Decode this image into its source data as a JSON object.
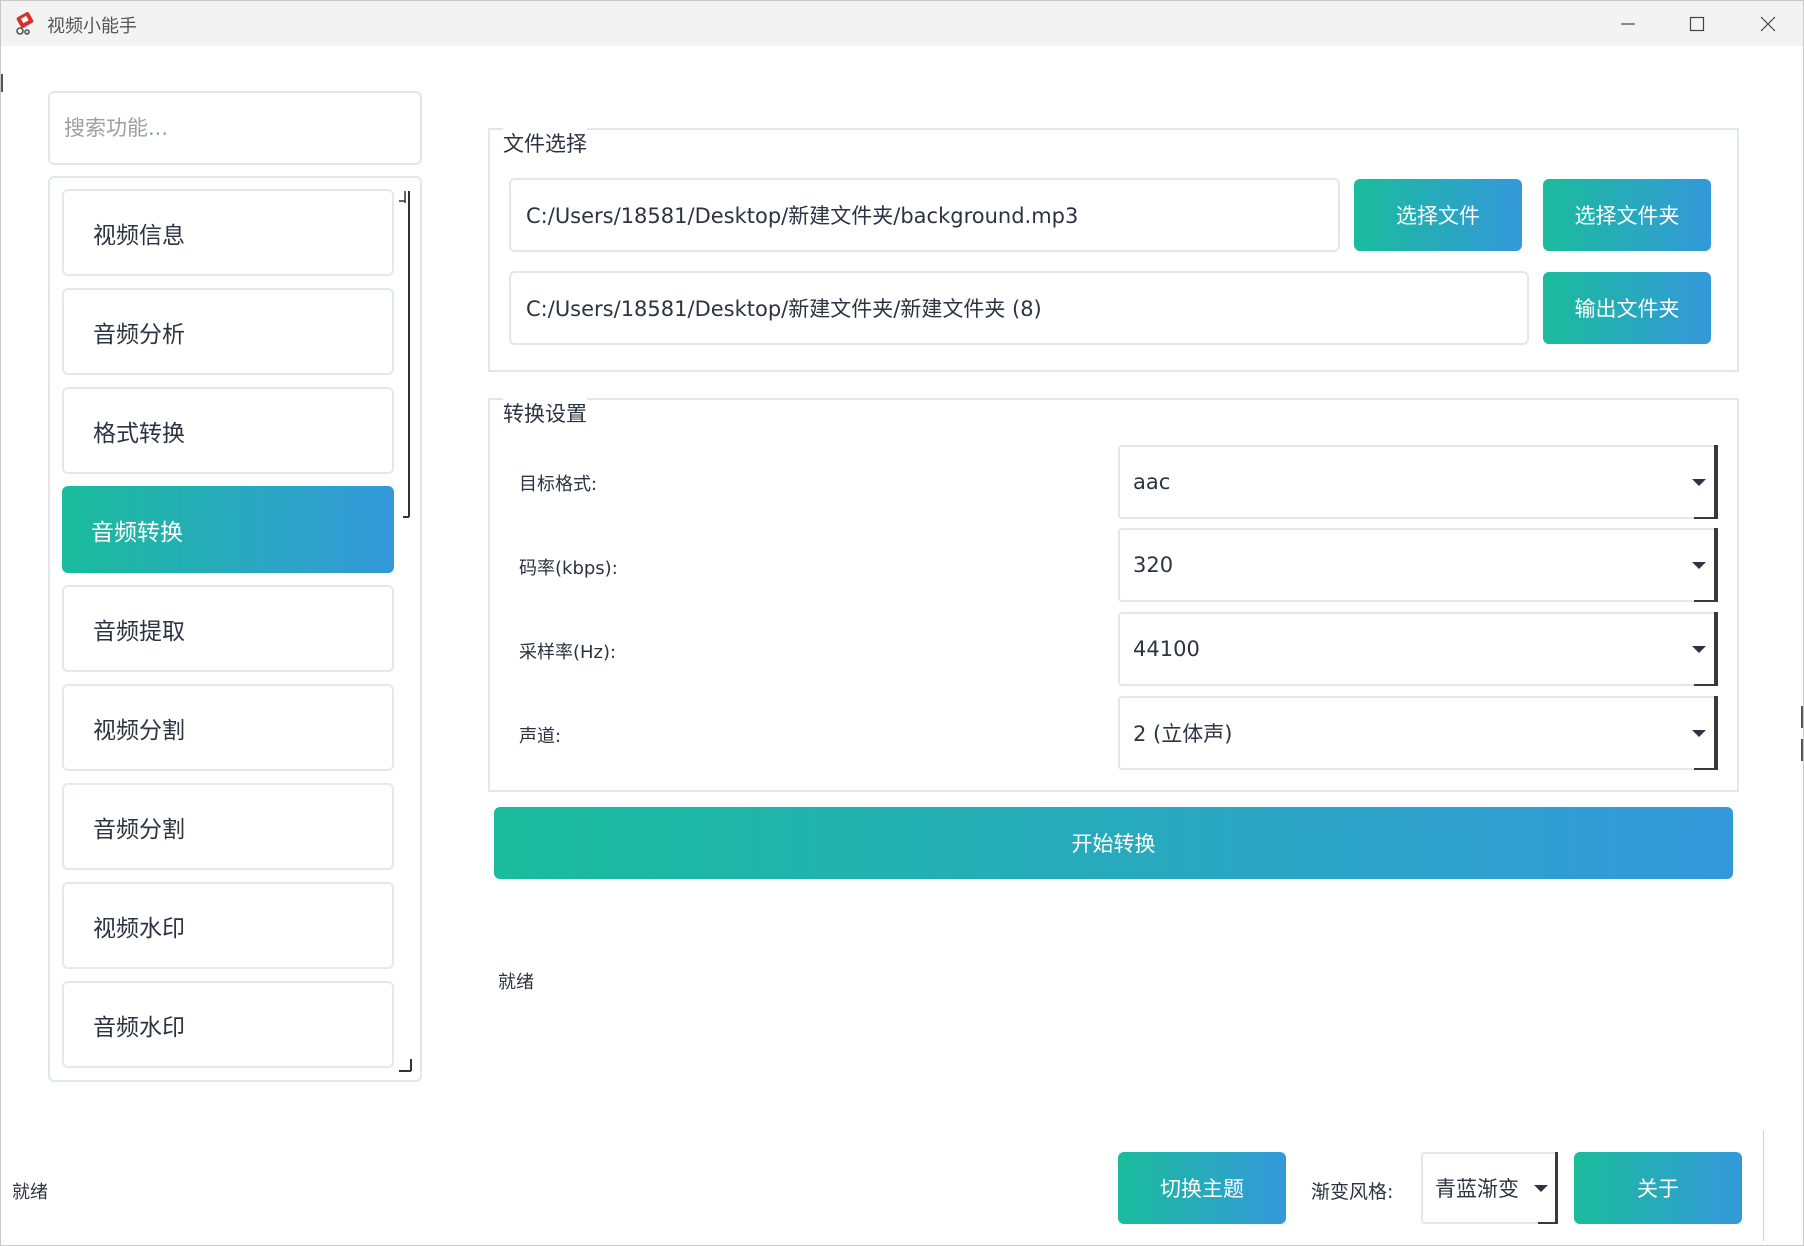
{
  "window": {
    "title": "视频小能手",
    "app_icon": "app-logo-icon",
    "controls": [
      "minimize-icon",
      "maximize-icon",
      "close-icon"
    ]
  },
  "sidebar": {
    "search_placeholder": "搜索功能...",
    "items": [
      {
        "label": "视频信息",
        "active": false
      },
      {
        "label": "音频分析",
        "active": false
      },
      {
        "label": "格式转换",
        "active": false
      },
      {
        "label": "音频转换",
        "active": true
      },
      {
        "label": "音频提取",
        "active": false
      },
      {
        "label": "视频分割",
        "active": false
      },
      {
        "label": "音频分割",
        "active": false
      },
      {
        "label": "视频水印",
        "active": false
      },
      {
        "label": "音频水印",
        "active": false
      }
    ]
  },
  "file_group": {
    "title": "文件选择",
    "input_path": "C:/Users/18581/Desktop/新建文件夹/background.mp3",
    "output_path": "C:/Users/18581/Desktop/新建文件夹/新建文件夹 (8)",
    "select_file_label": "选择文件",
    "select_folder_label": "选择文件夹",
    "output_folder_label": "输出文件夹"
  },
  "settings_group": {
    "title": "转换设置",
    "rows": [
      {
        "label": "目标格式:",
        "value": "aac"
      },
      {
        "label": "码率(kbps):",
        "value": "320"
      },
      {
        "label": "采样率(Hz):",
        "value": "44100"
      },
      {
        "label": "声道:",
        "value": "2 (立体声)"
      }
    ]
  },
  "start_button_label": "开始转换",
  "panel_status": "就绪",
  "footer": {
    "status": "就绪",
    "switch_theme_label": "切换主题",
    "gradient_style_label": "渐变风格:",
    "gradient_style_value": "青蓝渐变",
    "about_label": "关于"
  },
  "colors": {
    "gradient_start": "#1abc9c",
    "gradient_end": "#3498db",
    "border": "#e3e6ea",
    "text": "#2b3440"
  }
}
